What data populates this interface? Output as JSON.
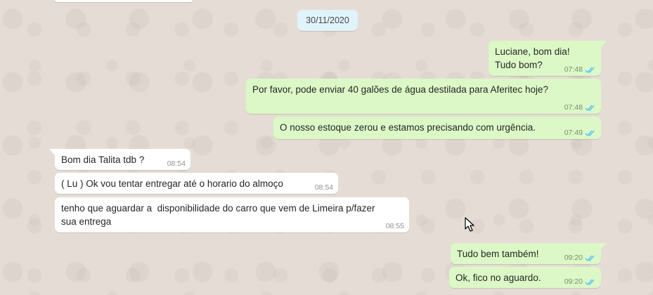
{
  "chat": {
    "date_chip": "30/11/2020",
    "colors": {
      "background": "#e5ddd5",
      "outgoing": "#dcf8c6",
      "incoming": "#ffffff",
      "date_chip": "#e1f3fb",
      "read_ticks": "#4fc3f7"
    },
    "messages": [
      {
        "direction": "outgoing",
        "lines": [
          "Luciane, bom dia!",
          "Tudo bom?"
        ],
        "time": "07:48",
        "status": "read"
      },
      {
        "direction": "outgoing",
        "lines": [
          "Por favor, pode enviar 40 galões de água destilada para Aferitec hoje?"
        ],
        "time": "07:48",
        "status": "read"
      },
      {
        "direction": "outgoing",
        "lines": [
          "O nosso estoque zerou e estamos precisando com urgência."
        ],
        "time": "07:49",
        "status": "read"
      },
      {
        "direction": "incoming",
        "lines": [
          "Bom dia Talita tdb ?"
        ],
        "time": "08:54"
      },
      {
        "direction": "incoming",
        "lines": [
          "( Lu ) Ok vou tentar entregar até o horario do almoço"
        ],
        "time": "08:54"
      },
      {
        "direction": "incoming",
        "lines": [
          "tenho que aguardar a  disponibilidade do carro que vem de Limeira p/fazer",
          "sua entrega"
        ],
        "time": "08:55"
      },
      {
        "direction": "outgoing",
        "lines": [
          "Tudo bem também!"
        ],
        "time": "09:20",
        "status": "read"
      },
      {
        "direction": "outgoing",
        "lines": [
          "Ok, fico no aguardo."
        ],
        "time": "09:20",
        "status": "read"
      }
    ]
  }
}
